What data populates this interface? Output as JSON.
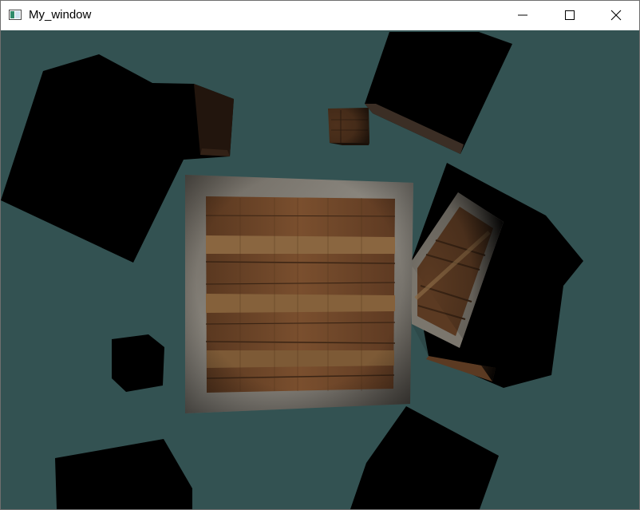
{
  "window": {
    "title": "My_window"
  },
  "scene": {
    "clear_color": "#335252",
    "crate_wood_color": "#6a4327",
    "crate_metal_color": "#8c8880",
    "shadow_color": "#000000"
  },
  "icons": {
    "app": "window-app-icon",
    "minimize": "minimize-icon",
    "maximize": "maximize-icon",
    "close": "close-icon"
  }
}
